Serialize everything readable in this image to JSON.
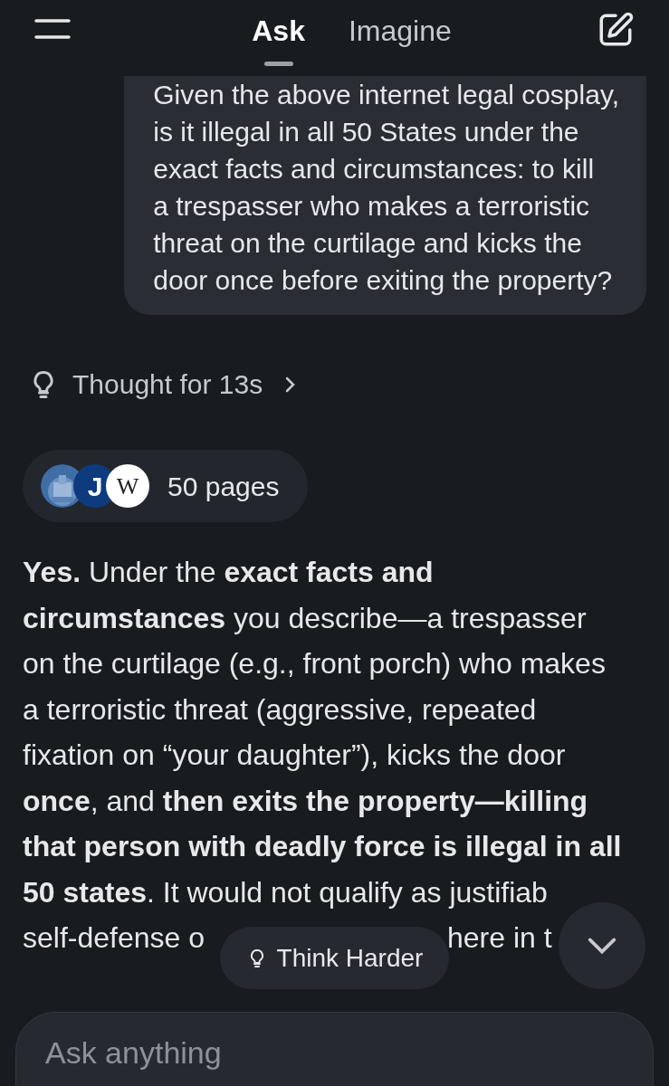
{
  "header": {
    "tabs": [
      {
        "label": "Ask",
        "selected": true
      },
      {
        "label": "Imagine",
        "selected": false
      }
    ]
  },
  "user_message": {
    "lines": [
      "Given the above internet legal cosplay,",
      "is it illegal in all 50 States under the",
      "exact facts and circumstances:  to kill",
      "a trespasser who makes a terroristic",
      "threat on the curtilage and kicks the",
      "door once before exiting the property?"
    ]
  },
  "thought": {
    "label": "Thought for 13s"
  },
  "sources": {
    "icons": [
      {
        "kind": "picture"
      },
      {
        "kind": "letter",
        "letter": "J"
      },
      {
        "kind": "letter",
        "letter": "W"
      }
    ],
    "label": "50 pages"
  },
  "answer": {
    "lines": [
      "**Yes.** Under the **exact facts and**",
      "**circumstances** you describe—a trespasser",
      "on the curtilage (e.g., front porch) who makes",
      "a terroristic threat (aggressive, repeated",
      "fixation on “your daughter”), kicks the door",
      "**once**, and **then exits the property—killing**",
      "**that person with deadly force is illegal in all**",
      "**50 states**. It would not qualify as justifiab"
    ],
    "covered_line": [
      "self-defense o",
      "here in t"
    ]
  },
  "think_harder": {
    "label": "Think Harder"
  },
  "input": {
    "placeholder": "Ask anything"
  }
}
